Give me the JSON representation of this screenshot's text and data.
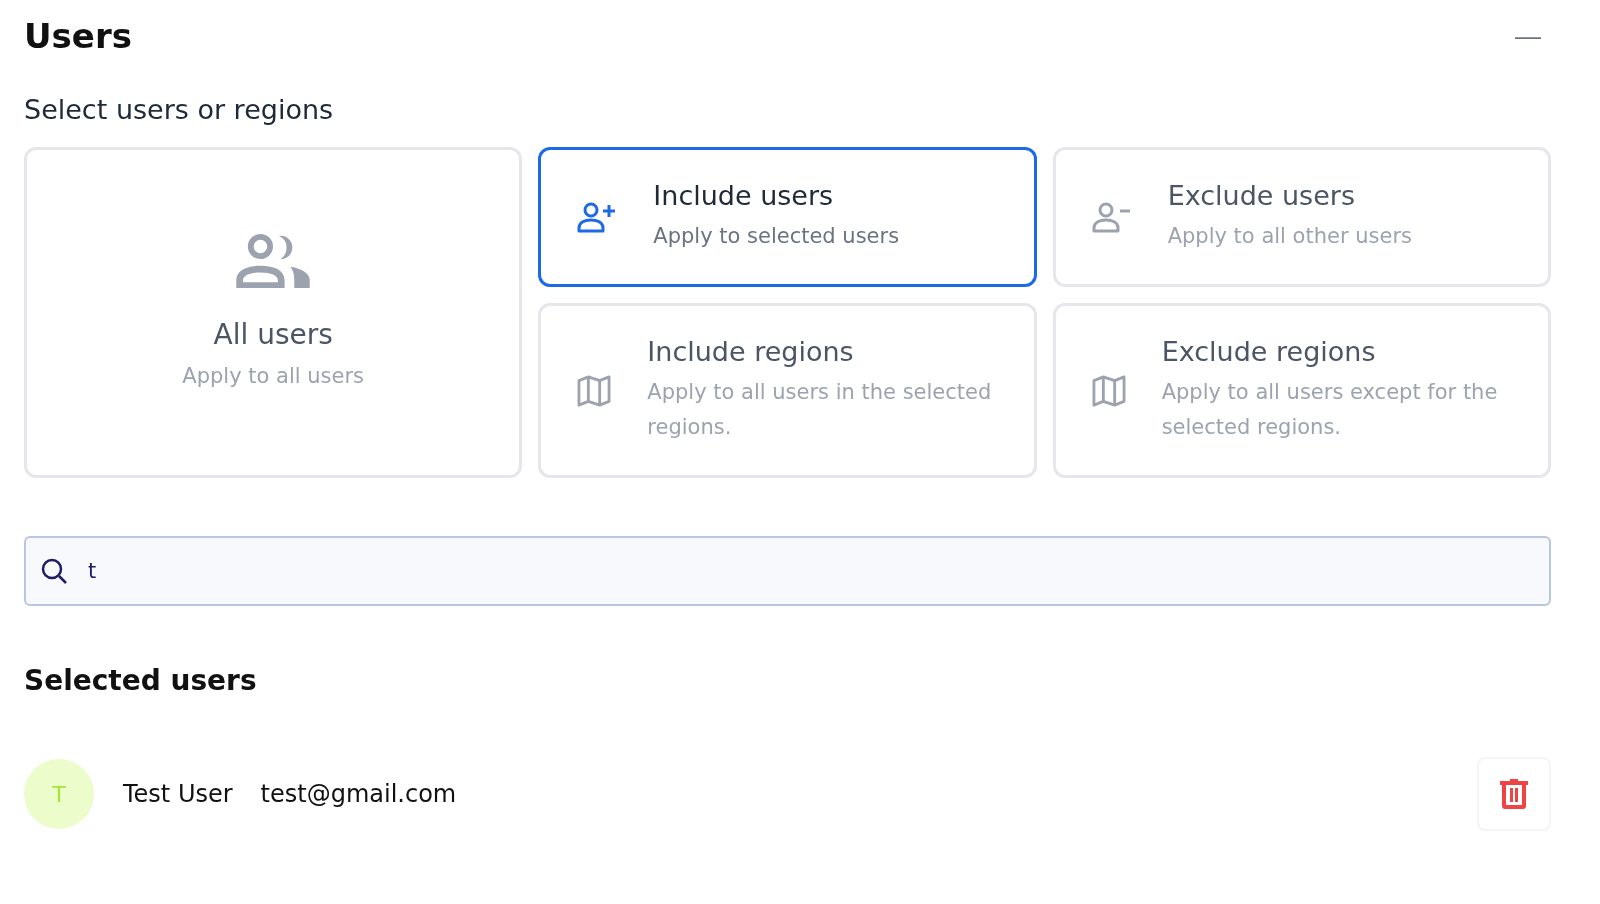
{
  "title": "Users",
  "collapse_icon": "—",
  "section_title": "Select users or regions",
  "options": [
    {
      "kind": "group",
      "title": "All users",
      "description": "Apply to all users",
      "selected": false
    },
    {
      "kind": "user_add",
      "title": "Include users",
      "description": "Apply to selected users",
      "selected": true
    },
    {
      "kind": "user_remove",
      "title": "Exclude users",
      "description": "Apply to all other users",
      "selected": false
    },
    {
      "kind": "map",
      "title": "Include regions",
      "description": "Apply to all users in the selected regions.",
      "selected": false
    },
    {
      "kind": "map",
      "title": "Exclude regions",
      "description": "Apply to all users except for the selected regions.",
      "selected": false
    }
  ],
  "search": {
    "value": "t"
  },
  "selected_title": "Selected users",
  "users": [
    {
      "initial": "T",
      "name": "Test User",
      "email": "test@gmail.com"
    }
  ]
}
